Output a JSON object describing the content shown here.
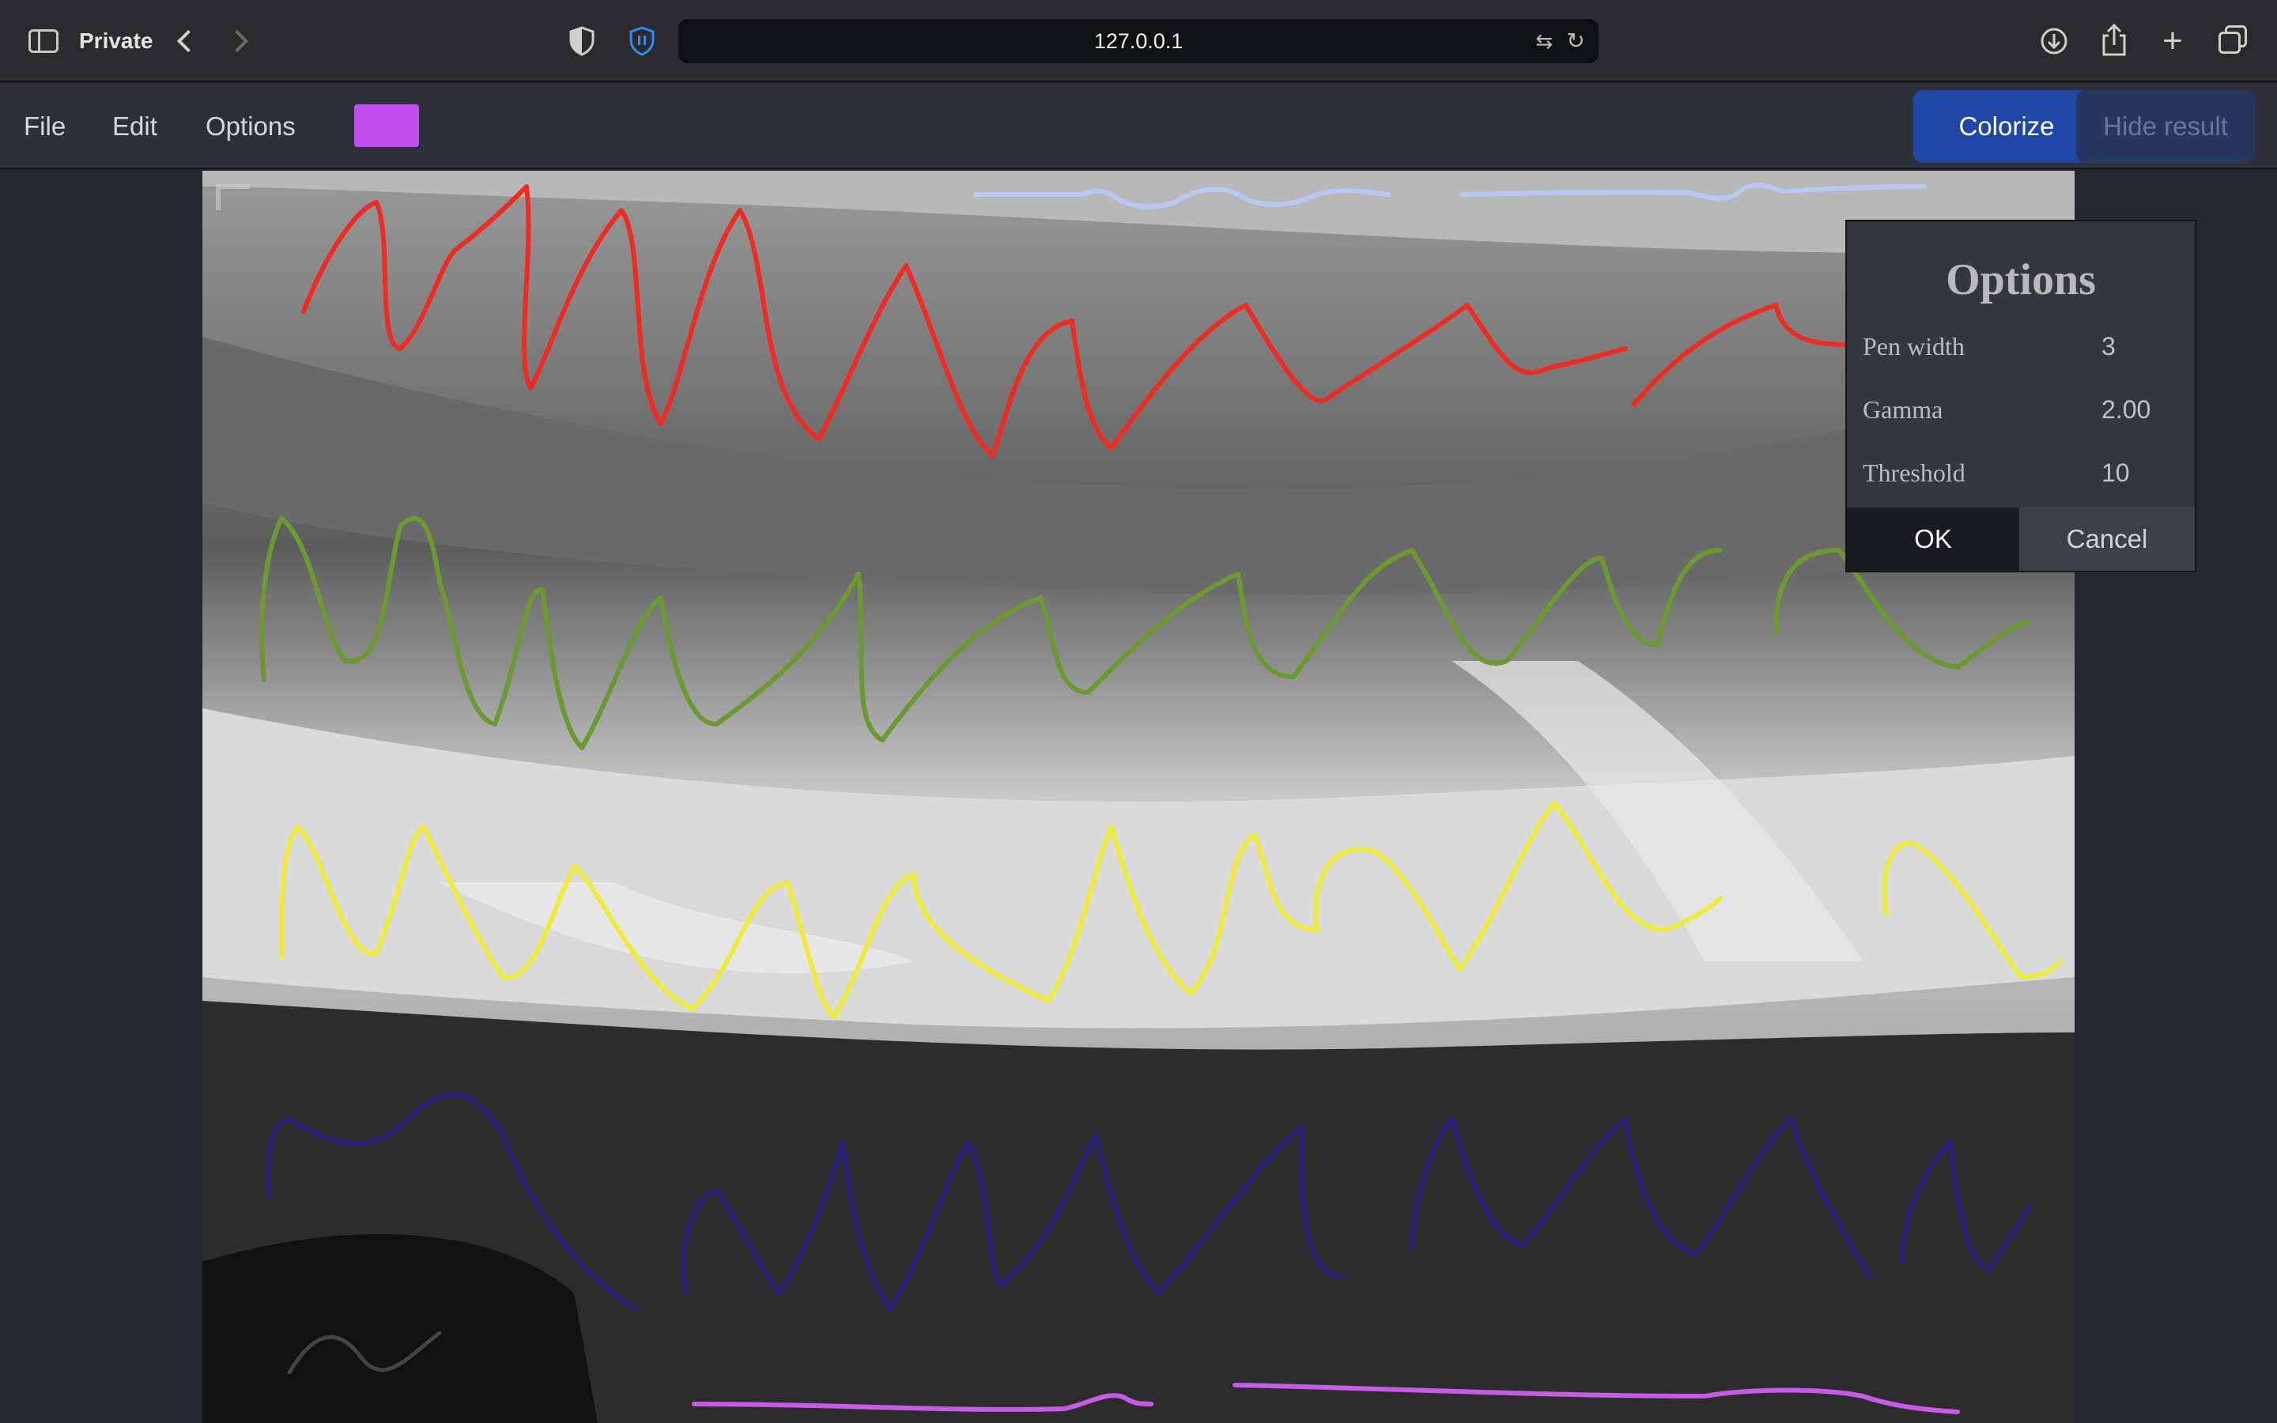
{
  "browser": {
    "private_label": "Private",
    "url": "127.0.0.1"
  },
  "menu": {
    "file": "File",
    "edit": "Edit",
    "options": "Options"
  },
  "toolbar": {
    "pen_color": "#c04ff0",
    "colorize_label": "Colorize",
    "hide_result_label": "Hide result"
  },
  "canvas": {
    "stroke_colors": [
      "#ef2b22",
      "#6a9a30",
      "#f0ea3a",
      "#2a1f7a",
      "#c85ae8",
      "#b8c8f4"
    ]
  },
  "options_dialog": {
    "title": "Options",
    "fields": [
      {
        "label": "Pen width",
        "value": "3"
      },
      {
        "label": "Gamma",
        "value": "2.00"
      },
      {
        "label": "Threshold",
        "value": "10"
      }
    ],
    "ok_label": "OK",
    "cancel_label": "Cancel"
  }
}
